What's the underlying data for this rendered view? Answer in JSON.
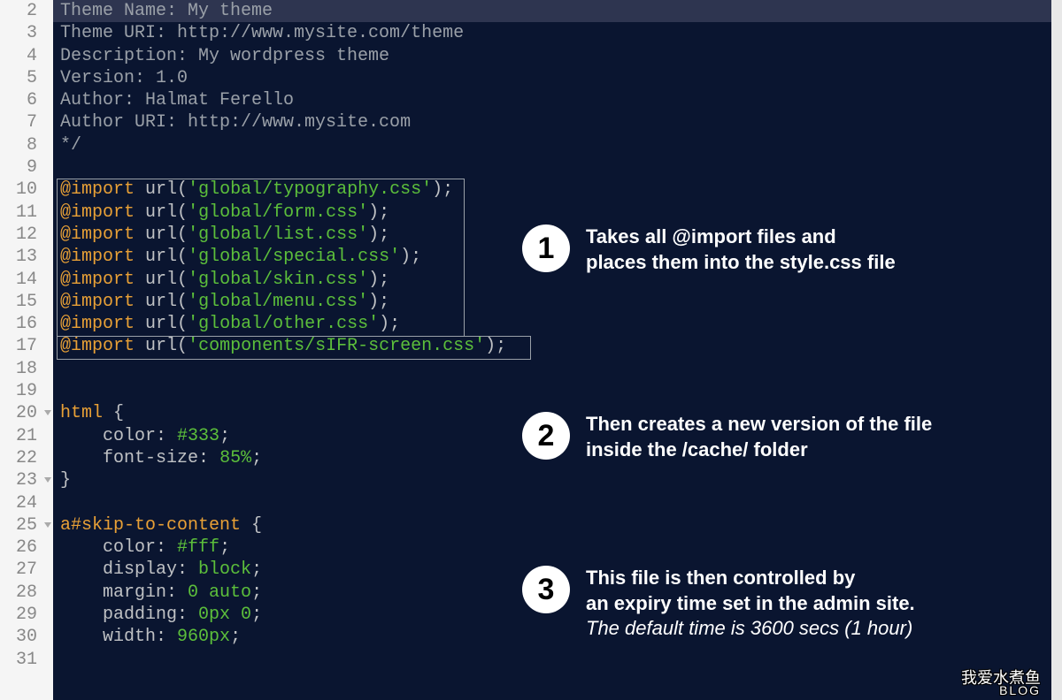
{
  "gutter": {
    "start": 2,
    "end": 31,
    "fold_lines": [
      20,
      23,
      25
    ]
  },
  "code": {
    "l2": "Theme Name: My theme",
    "l3": "Theme URI: http://www.mysite.com/theme",
    "l4": "Description: My wordpress theme",
    "l5": "Version: 1.0",
    "l6": "Author: Halmat Ferello",
    "l7": "Author URI: http://www.mysite.com",
    "l8": "*/",
    "import_kw": "@import",
    "import_fn": "url",
    "i10": "'global/typography.css'",
    "i11": "'global/form.css'",
    "i12": "'global/list.css'",
    "i13": "'global/special.css'",
    "i14": "'global/skin.css'",
    "i15": "'global/menu.css'",
    "i16": "'global/other.css'",
    "i17": "'components/sIFR-screen.css'",
    "sel20": "html",
    "p21": "color",
    "v21": "#333",
    "p22": "font-size",
    "v22": "85%",
    "sel25": "a#skip-to-content",
    "p26": "color",
    "v26": "#fff",
    "p27": "display",
    "v27": "block",
    "p28": "margin",
    "v28": "0 auto",
    "p29": "padding",
    "v29": "0px 0",
    "p30": "width",
    "v30": "960px",
    "brace_open": " {",
    "brace_close": "}",
    "paren_open": "(",
    "paren_close": ");",
    "colon": ": ",
    "semi": ";"
  },
  "annotations": {
    "a1": {
      "num": "1",
      "line1": "Takes all @import files and",
      "line2": "places them into the style.css file"
    },
    "a2": {
      "num": "2",
      "line1": "Then creates a new version of the file",
      "line2": "inside the /cache/ folder"
    },
    "a3": {
      "num": "3",
      "line1": "This file is then controlled by",
      "line2": "an expiry time set in the admin site.",
      "line3": "The default time is 3600 secs (1 hour)"
    }
  },
  "watermark": {
    "cn": "我爱水煮鱼",
    "en": "BLOG"
  }
}
